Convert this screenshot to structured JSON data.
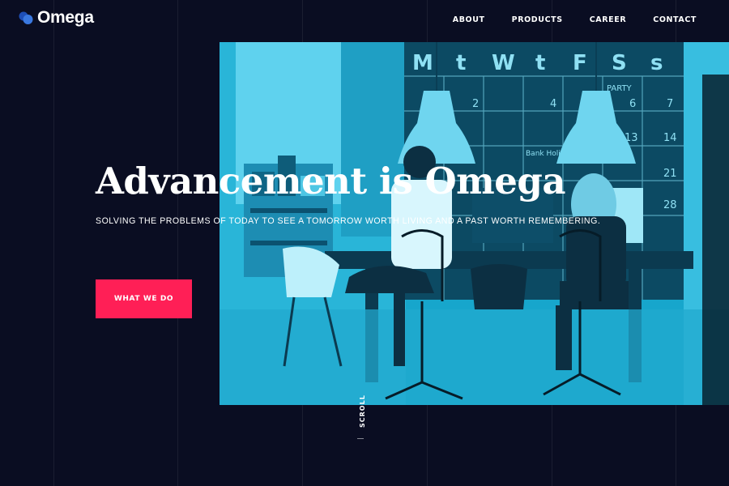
{
  "brand": {
    "name": "Omega",
    "logo_icon": "blue-circles-logo-icon",
    "logo_color": "#2f6bd6"
  },
  "nav": {
    "items": [
      {
        "label": "ABOUT"
      },
      {
        "label": "PRODUCTS"
      },
      {
        "label": "CAREER"
      },
      {
        "label": "CONTACT"
      }
    ]
  },
  "hero": {
    "headline": "Advancement is Omega",
    "subheadline": "SOLVING THE PROBLEMS OF TODAY TO SEE A TOMORROW WORTH LIVING AND A PAST WORTH REMEMBERING.",
    "cta_label": "WHAT WE DO",
    "cta_color": "#ff1f56",
    "scroll_label": "SCROLL",
    "photo_tint": "#17a6cc",
    "board_letters": [
      "M",
      "t",
      "W",
      "t",
      "F",
      "S",
      "s"
    ],
    "board_numbers": [
      "2",
      "4",
      "6",
      "7",
      "13",
      "14",
      "21",
      "28"
    ],
    "board_notes": [
      "PARTY",
      "Bank Holiday"
    ]
  },
  "colors": {
    "background": "#0a0d22",
    "text": "#ffffff"
  }
}
